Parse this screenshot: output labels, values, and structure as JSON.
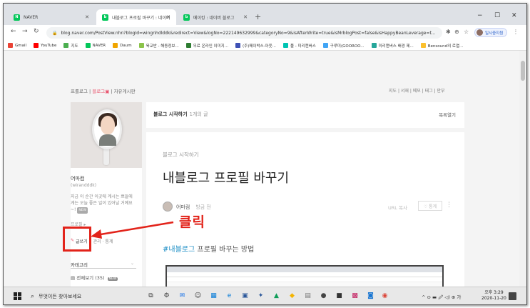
{
  "browser": {
    "tabs": [
      {
        "title": "NAVER",
        "icon": "naver-icon",
        "active": false
      },
      {
        "title": "내블로그 프로필 바꾸기 : 네이버",
        "icon": "naver-blog-icon",
        "active": true
      },
      {
        "title": "메이킹 : 네이버 블로그",
        "icon": "naver-blog-icon",
        "active": false
      }
    ],
    "new_tab_label": "+",
    "url": "blog.naver.com/PostView.nhn?blogId=wingnhdlddk&redirect=View&logNo=222149632999&categoryNo=9&isAfterWrite=true&isMrblogPost=false&isHappyBeanLeverage=t...",
    "profile_label": "일시중지됨",
    "bookmarks": [
      "Gmail",
      "YouTube",
      "지도",
      "NAVER",
      "Daum",
      "육교반 - 해동정보...",
      "무료 온라인 이미지...",
      "(주)메이박스-아웃...",
      "풀 - 미리캔버스",
      "구루미(GOOROO...",
      "미리캔버스 배경 제...",
      "Bensound의 로열..."
    ]
  },
  "blog": {
    "top_menu": {
      "prologue": "프롤로그",
      "blog": "블로그",
      "board": "자유게시판"
    },
    "top_right": "지도 | 서재 | 메모 | 태그 | 안부",
    "profile": {
      "nickname": "어마컴",
      "user_id": "(wirandddk)",
      "bio": "지금 이 순간 이곳에 계시는 쁘들에게는 오늘 좋은 일이 있어날 거예요~!",
      "new_badge": "NEW",
      "profile_link": "프로필 ▸",
      "write_label": "글쓰기",
      "admin_label": "관리 · 통계"
    },
    "category": {
      "title": "카테고리",
      "all_label": "전체보기 (35)",
      "new_badge": "NEW"
    },
    "main": {
      "header": "블로그 시작하기",
      "count": "1개의 글",
      "list_toggle": "목록열기",
      "post": {
        "category": "블로그 시작하기",
        "title": "내블로그 프로필 바꾸기",
        "author": "어마컴",
        "date": "방금 전",
        "url_copy": "URL 복사",
        "likes": "♡ 통계",
        "hashtag": "#내블로그",
        "hashtag_rest": " 프로필 바꾸는 방법"
      }
    },
    "annotation": {
      "click_label": "클릭",
      "color": "#e2231a"
    }
  },
  "taskbar": {
    "search_placeholder": "무엇이든 찾아보세요",
    "tray": "^ ⊙ ▬ 🖉 ◁) ⊕ 가",
    "time": "오후 3:29",
    "date": "2020-11-20"
  }
}
